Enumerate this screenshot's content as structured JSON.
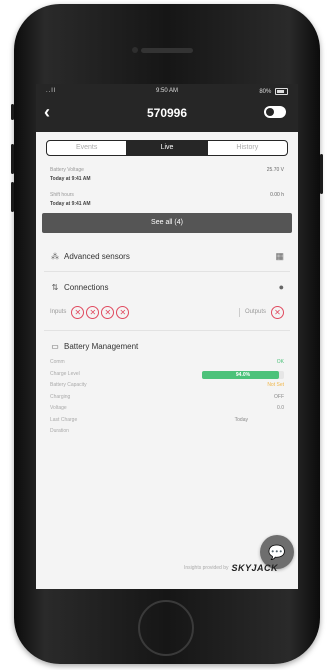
{
  "status_bar": {
    "signal": "..ll",
    "time": "9:50 AM",
    "battery": "80%"
  },
  "nav": {
    "back_glyph": "‹",
    "title": "570996"
  },
  "tabs": [
    {
      "label": "Events",
      "active": false
    },
    {
      "label": "Live",
      "active": true
    },
    {
      "label": "History",
      "active": false
    }
  ],
  "metrics": [
    {
      "label": "Battery Voltage",
      "value": "25.70 V"
    },
    {
      "sub": "Today at 9:41 AM"
    },
    {
      "label": "Shift hours",
      "value": "0.00 h"
    },
    {
      "sub": "Today at 9:41 AM"
    }
  ],
  "see_all": "See all (4)",
  "advanced_sensors": {
    "title": "Advanced sensors",
    "icon": "sensor-icon"
  },
  "connections": {
    "title": "Connections",
    "icon": "connections-icon",
    "inputs_label": "Inputs",
    "inputs_count": 4,
    "outputs_label": "Outputs",
    "x_glyph": "✕"
  },
  "battery_management": {
    "title": "Battery Management",
    "icon": "battery-icon",
    "rows": [
      {
        "label": "Comm",
        "value": "OK",
        "color": "green"
      },
      {
        "label": "Charge Level",
        "bar_label": "94.0%",
        "level": 0.94
      },
      {
        "label": "Battery Capacity",
        "value": "Not Set",
        "color": "orange"
      },
      {
        "label": "Charging",
        "value": "OFF"
      },
      {
        "label": "Voltage",
        "value": "0.0"
      },
      {
        "label": "Last Charge",
        "value": "Today"
      },
      {
        "label": "Duration",
        "value": ""
      }
    ]
  },
  "footer": {
    "text": "Insights provided by",
    "brand": "SKYJACK"
  },
  "fab_icon": "chat-icon",
  "colors": {
    "primary": "#262626",
    "success": "#4cc27a",
    "danger": "#e04a5f",
    "warning": "#f0b64a"
  }
}
